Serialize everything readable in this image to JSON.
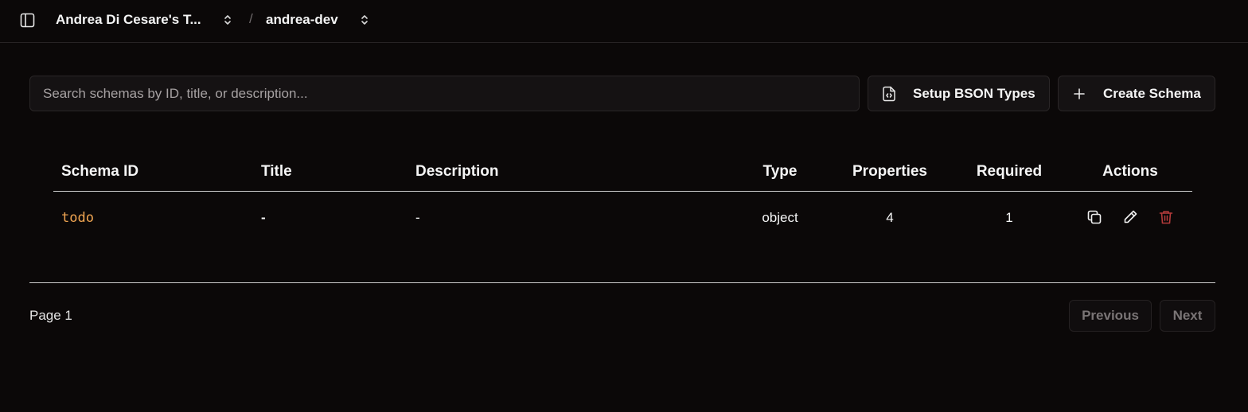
{
  "header": {
    "team_name": "Andrea Di Cesare's T...",
    "separator": "/",
    "project_name": "andrea-dev"
  },
  "search": {
    "placeholder": "Search schemas by ID, title, or description...",
    "value": ""
  },
  "toolbar": {
    "setup_bson_label": "Setup BSON Types",
    "create_schema_label": "Create Schema"
  },
  "table": {
    "columns": {
      "schema_id": "Schema ID",
      "title": "Title",
      "description": "Description",
      "type": "Type",
      "properties": "Properties",
      "required": "Required",
      "actions": "Actions"
    },
    "rows": [
      {
        "schema_id": "todo",
        "title": "-",
        "description": "-",
        "type": "object",
        "properties": "4",
        "required": "1"
      }
    ]
  },
  "pagination": {
    "page_label": "Page 1",
    "previous_label": "Previous",
    "next_label": "Next"
  },
  "colors": {
    "background": "#0b0808",
    "accent_schema_id": "#f0a552",
    "delete_icon": "#b33a3a",
    "muted_text": "#7a7576"
  },
  "icons": {
    "sidebar_toggle": "sidebar-panel-icon",
    "breadcrumb_chevron": "chevron-up-down-icon",
    "bson": "file-code-icon",
    "create": "plus-icon",
    "copy": "copy-icon",
    "edit": "pencil-icon",
    "delete": "trash-icon"
  }
}
